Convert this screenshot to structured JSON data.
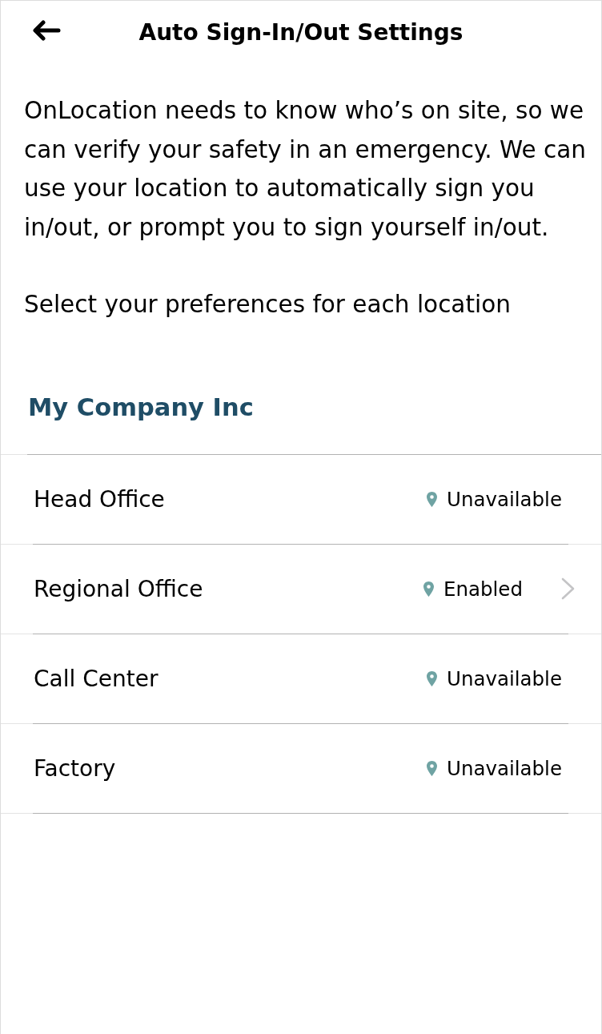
{
  "header": {
    "title": "Auto Sign-In/Out Settings"
  },
  "intro": [
    "OnLocation needs to know who’s on site, so we can verify your safety in an emergency. We can use your location to automatically sign you in/out, or prompt you to sign yourself in/out.",
    "Select your preferences for each location"
  ],
  "company": {
    "name": "My Company Inc"
  },
  "locations": [
    {
      "name": "Head Office",
      "status": "Unavailable",
      "chevron": false
    },
    {
      "name": "Regional Office",
      "status": "Enabled",
      "chevron": true
    },
    {
      "name": "Call Center",
      "status": "Unavailable",
      "chevron": false
    },
    {
      "name": "Factory",
      "status": "Unavailable",
      "chevron": false
    }
  ]
}
